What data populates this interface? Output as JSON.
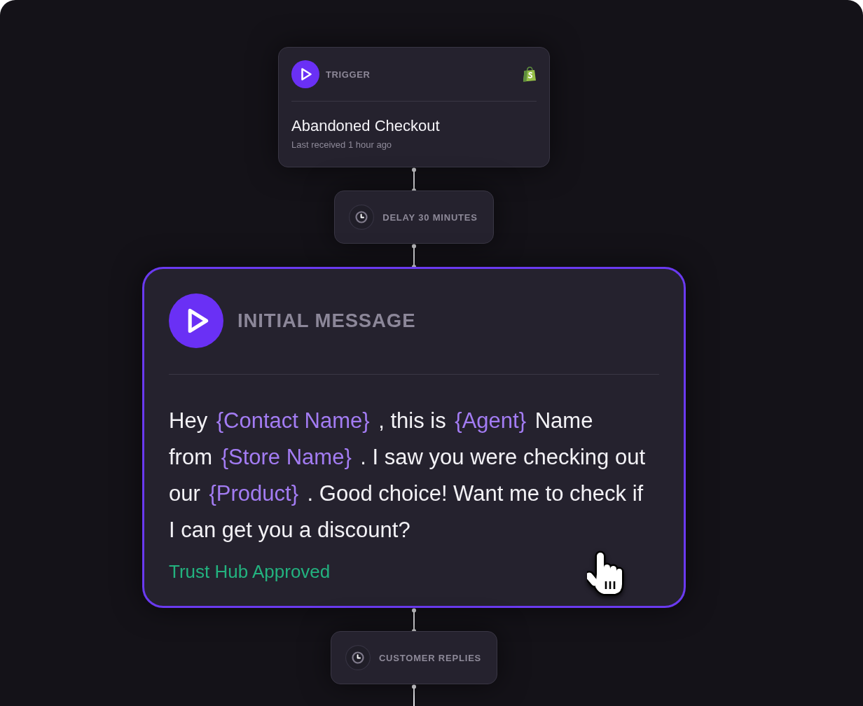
{
  "flow": {
    "nodes": [
      {
        "kind": "trigger",
        "selected": false,
        "label": "TRIGGER",
        "title": "Abandoned Checkout",
        "subtitle": "Last received 1 hour ago"
      },
      {
        "kind": "step",
        "selected": false,
        "label": "DELAY 30 MINUTES"
      },
      {
        "kind": "message",
        "selected": true,
        "label": "INITIAL MESSAGE",
        "lines": [
          [
            {
              "kind": "text",
              "text": "Hey"
            },
            {
              "kind": "variable",
              "text": "{Contact Name}"
            },
            {
              "kind": "text",
              "text": ", this is"
            },
            {
              "kind": "variable",
              "text": "{Agent}"
            },
            {
              "kind": "text",
              "text": "Name"
            }
          ],
          [
            {
              "kind": "text",
              "text": "from"
            },
            {
              "kind": "variable",
              "text": "{Store Name}"
            },
            {
              "kind": "text",
              "text": ". I saw you were checking out"
            }
          ],
          [
            {
              "kind": "text",
              "text": "our"
            },
            {
              "kind": "variable",
              "text": "{Product}"
            },
            {
              "kind": "text",
              "text": ". Good choice! Want me to check if"
            }
          ],
          [
            {
              "kind": "text",
              "text": "I can get you a discount?"
            }
          ]
        ],
        "status": "Trust Hub Approved"
      },
      {
        "kind": "step",
        "selected": false,
        "label": "CUSTOMER REPLIES"
      }
    ]
  }
}
